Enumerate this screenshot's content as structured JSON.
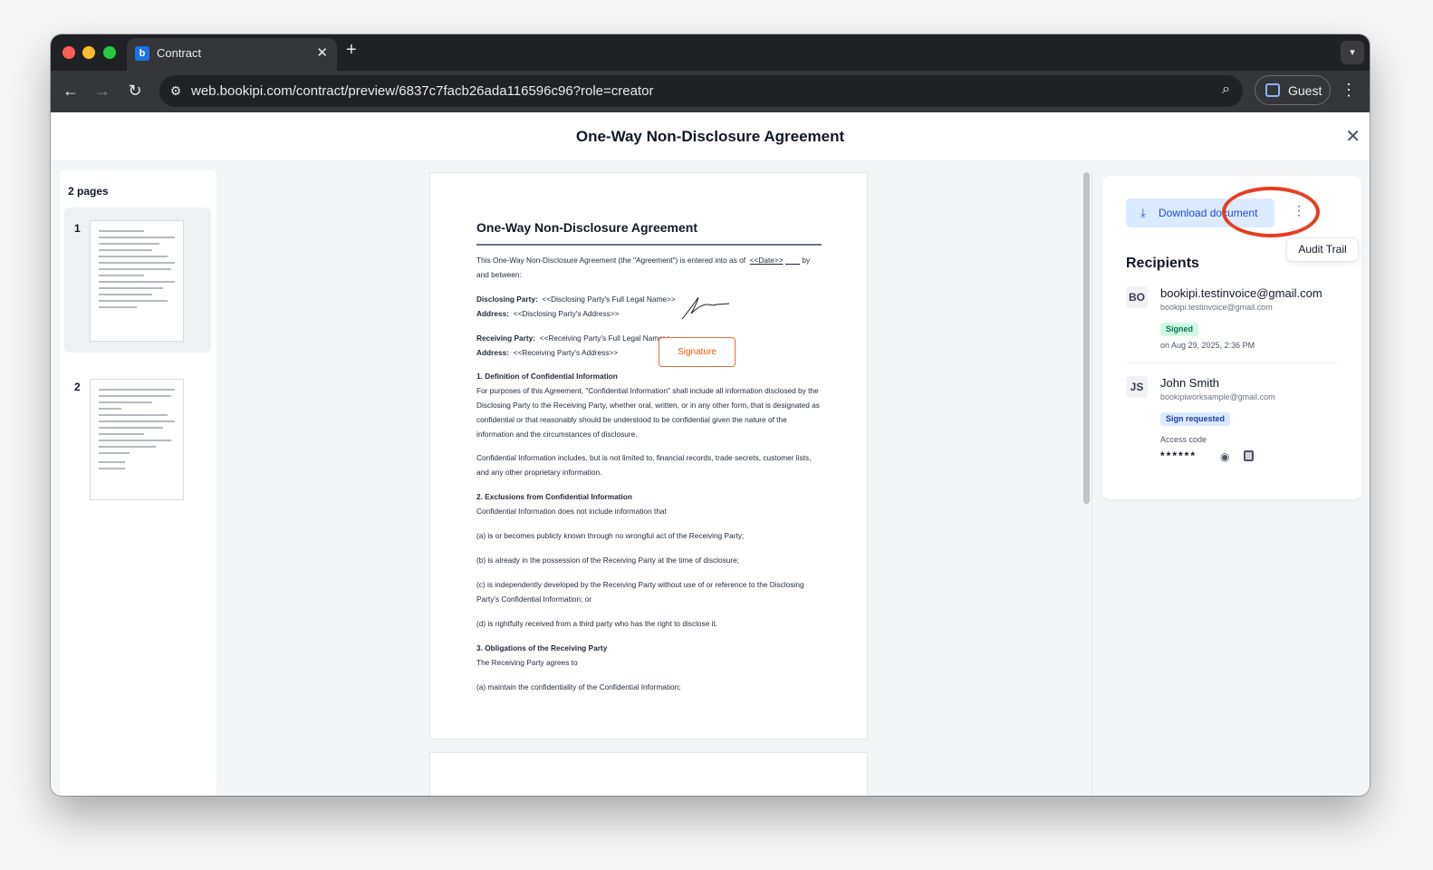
{
  "browser": {
    "tab_title": "Contract",
    "favicon_letter": "b",
    "url": "web.bookipi.com/contract/preview/6837c7facb26ada116596c96?role=creator",
    "profile_label": "Guest",
    "icons": [
      "back-arrow-icon",
      "forward-arrow-icon",
      "reload-icon",
      "site-settings-icon",
      "zoom-icon",
      "profile-icon",
      "more-vert-icon"
    ]
  },
  "header": {
    "title": "One-Way Non-Disclosure Agreement"
  },
  "thumbnails": {
    "pages_label": "2 pages",
    "pages": [
      {
        "number": "1"
      },
      {
        "number": "2"
      }
    ]
  },
  "document": {
    "heading": "One-Way Non-Disclosure Agreement",
    "intro_a": "This One-Way Non-Disclosure Agreement (the \"Agreement\") is entered into as of",
    "date_placeholder": "<<Date>>",
    "intro_b": "by",
    "intro_c": "and between:",
    "disclosing_label": "Disclosing Party:",
    "disclosing_name": "<<Disclosing Party's Full Legal Name>>",
    "disclosing_address_label": "Address:",
    "disclosing_address": "<<Disclosing Party's Address>>",
    "receiving_label": "Receiving Party:",
    "receiving_name": "<<Receiving Party's Full Legal Name>>",
    "receiving_address_label": "Address:",
    "receiving_address": "<<Receiving Party's Address>>",
    "signature_field": "Signature",
    "s1_title": "1. Definition of Confidential Information",
    "s1_p1": "For purposes of this Agreement, \"Confidential Information\" shall include all information disclosed by the Disclosing Party to the Receiving Party, whether oral, written, or in any other form, that is designated as confidential or that reasonably should be understood to be confidential given the nature of the information and the circumstances of disclosure.",
    "s1_p2": "Confidential Information includes, but is not limited to, financial records, trade secrets, customer lists, and any other proprietary information.",
    "s2_title": "2. Exclusions from Confidential Information",
    "s2_p1": "Confidential Information does not include information that",
    "s2_a": "(a) is or becomes publicly known through no wrongful act of the Receiving Party;",
    "s2_b": "(b) is already in the possession of the Receiving Party at the time of disclosure;",
    "s2_c": "(c) is independently developed by the Receiving Party without use of or reference to the Disclosing Party's Confidential Information; or",
    "s2_d": "(d) is rightfully received from a third party who has the right to disclose it.",
    "s3_title": "3. Obligations of the Receiving Party",
    "s3_p1": "The Receiving Party agrees to",
    "s3_a": "(a) maintain the confidentiality of the Confidential Information;"
  },
  "panel": {
    "download_label": "Download document",
    "audit_trail_label": "Audit Trail",
    "recipients_title": "Recipients",
    "recipients": [
      {
        "initials": "BO",
        "name": "bookipi.testinvoice@gmail.com",
        "email": "bookipi.testinvoice@gmail.com",
        "status": "Signed",
        "signed_at": "on Aug 29, 2025, 2:36 PM"
      },
      {
        "initials": "JS",
        "name": "John Smith",
        "email": "bookipiworksample@gmail.com",
        "status": "Sign requested",
        "access_code_label": "Access code",
        "access_code": "******"
      }
    ]
  },
  "colors": {
    "accent": "#1d4ed8",
    "signed": "#047857",
    "signature_field": "#ea580c",
    "annotation": "#e53e21"
  }
}
